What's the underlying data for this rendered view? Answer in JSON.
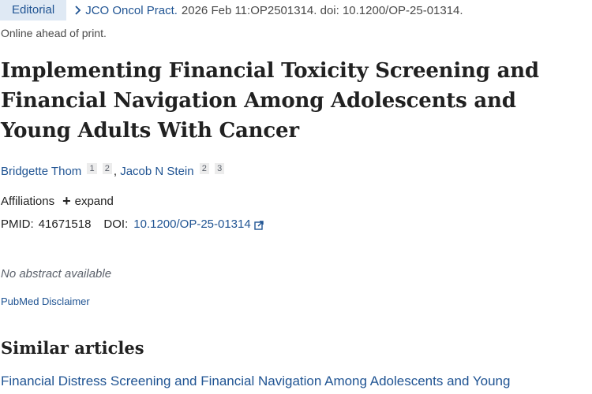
{
  "article": {
    "type_badge": "Editorial",
    "journal": "JCO Oncol Pract.",
    "citation": "2026 Feb 11:OP2501314. doi: 10.1200/OP-25-01314.",
    "status": "Online ahead of print.",
    "title": "Implementing Financial Toxicity Screening and Financial Navigation Among Adolescents and Young Adults With Cancer",
    "authors": [
      {
        "name": "Bridgette Thom",
        "affiliations": [
          "1",
          "2"
        ]
      },
      {
        "name": "Jacob N Stein",
        "affiliations": [
          "2",
          "3"
        ]
      }
    ],
    "author_separator": ",",
    "affiliations_label": "Affiliations",
    "expand_label": "expand",
    "pmid_label": "PMID:",
    "pmid": "41671518",
    "doi_label": "DOI:",
    "doi": "10.1200/OP-25-01314",
    "abstract_status": "No abstract available",
    "disclaimer_link": "PubMed Disclaimer"
  },
  "similar": {
    "heading": "Similar articles",
    "items": [
      "Financial Distress Screening and Financial Navigation Among Adolescents and Young"
    ]
  },
  "icons": {
    "chevron": "chevron-right-icon",
    "plus": "plus-icon",
    "external": "external-link-icon"
  },
  "colors": {
    "link": "#205493",
    "badge_bg": "#dfe9f4",
    "text": "#212121",
    "muted": "#4a4a4a"
  }
}
